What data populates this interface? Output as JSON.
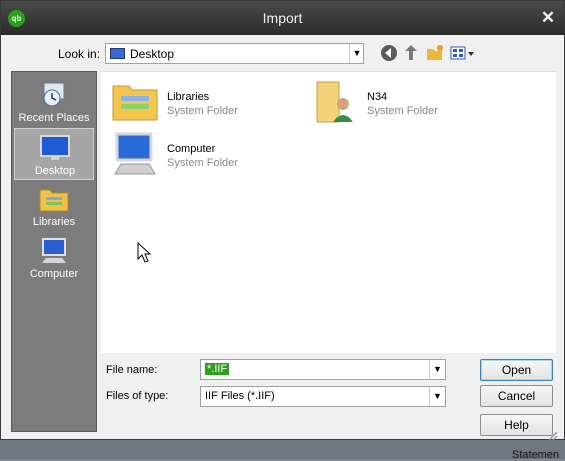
{
  "window": {
    "title": "Import",
    "logo_text": "qb"
  },
  "look_in": {
    "label": "Look in:",
    "value": "Desktop"
  },
  "places": [
    {
      "label": "Recent Places"
    },
    {
      "label": "Desktop"
    },
    {
      "label": "Libraries"
    },
    {
      "label": "Computer"
    }
  ],
  "items": [
    {
      "name": "Libraries",
      "type": "System Folder"
    },
    {
      "name": "N34",
      "type": "System Folder"
    },
    {
      "name": "Computer",
      "type": "System Folder"
    }
  ],
  "file_name": {
    "label": "File name:",
    "value": "*.IIF"
  },
  "files_of_type": {
    "label": "Files of type:",
    "value": "IIF Files (*.IIF)"
  },
  "buttons": {
    "open": "Open",
    "cancel": "Cancel",
    "help": "Help"
  },
  "background": {
    "statement_text": "Statemen"
  },
  "colors": {
    "accent": "#2ca01c",
    "titlebar": "#333333",
    "places_bg": "#7c7c7c"
  }
}
